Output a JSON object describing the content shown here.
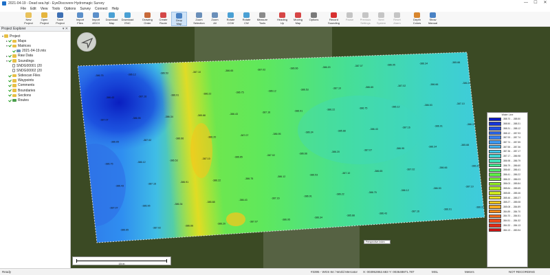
{
  "window": {
    "title": "2021-04-19 - Dead sea.hpl - EyeDiscovere Hydromagic Survey",
    "controls": [
      "—",
      "☐",
      "✕"
    ]
  },
  "menu": [
    "File",
    "Edit",
    "View",
    "Tools",
    "Options",
    "Survey",
    "Connect",
    "Help"
  ],
  "toolbar": [
    {
      "label": "New\nProject",
      "icon": "new-project-icon",
      "color": "#e9c25b"
    },
    {
      "label": "Open\nProject",
      "icon": "open-project-icon",
      "color": "#e5b53e"
    },
    {
      "label": "Save\nProject",
      "icon": "save-project-icon",
      "color": "#3d6fb3"
    },
    {
      "label": "Import\nFiles",
      "icon": "import-files-icon",
      "color": "#5b8fc9"
    },
    {
      "label": "Import\nASCII",
      "icon": "import-ascii-icon",
      "color": "#5b8fc9"
    },
    {
      "label": "Download\nMap",
      "icon": "download-map-icon",
      "color": "#4aa0d4"
    },
    {
      "label": "Download\nENC",
      "icon": "download-enc-icon",
      "color": "#4aa0d4"
    },
    {
      "label": "Drawing\nOrder",
      "icon": "drawing-order-icon",
      "color": "#c86a3a"
    },
    {
      "label": "Create\nRoute",
      "icon": "create-route-icon",
      "color": "#d44848"
    },
    {
      "label": "Drop\nMap",
      "icon": "drop-map-icon",
      "color": "#4a82c4"
    },
    {
      "label": "Zoom\nSelection",
      "icon": "zoom-selection-icon",
      "color": "#6a8fb9"
    },
    {
      "label": "Zoom\nAll",
      "icon": "zoom-all-icon",
      "color": "#6a8fb9"
    },
    {
      "label": "Rotate\nCCW",
      "icon": "rotate-ccw-icon",
      "color": "#4aa0d4"
    },
    {
      "label": "Rotate\nCW",
      "icon": "rotate-cw-icon",
      "color": "#4aa0d4"
    },
    {
      "label": "Measure\nTools",
      "icon": "measure-tools-icon",
      "color": "#8a8a8a"
    },
    {
      "label": "Heading\nUp",
      "icon": "heading-up-icon",
      "color": "#d64646"
    },
    {
      "label": "Moving\nMap",
      "icon": "moving-map-icon",
      "color": "#d64646"
    },
    {
      "label": "Options",
      "icon": "options-icon",
      "color": "#7a7a7a"
    },
    {
      "label": "Record\nSounding",
      "icon": "record-icon",
      "color": "#d83030"
    },
    {
      "label": "Pause",
      "icon": "pause-icon",
      "color": "#888888"
    },
    {
      "label": "Previous\nSettings",
      "icon": "previous-settings-icon",
      "color": "#888888"
    },
    {
      "label": "Next\nSystem",
      "icon": "next-system-icon",
      "color": "#888888"
    },
    {
      "label": "Reset\nAlarm",
      "icon": "reset-alarm-icon",
      "color": "#888888"
    },
    {
      "label": "Depth\nColors",
      "icon": "depth-colors-icon",
      "color": "#d8862e"
    },
    {
      "label": "Show\nManual",
      "icon": "show-manual-icon",
      "color": "#4a82c4"
    }
  ],
  "explorer": {
    "title": "Project Explorer",
    "controls": "▾ ✕",
    "tree": [
      {
        "label": "Project",
        "level": 0,
        "icon": "folder",
        "check": false,
        "expander": "▾"
      },
      {
        "label": "Maps",
        "level": 1,
        "icon": "folder",
        "check": true,
        "expander": "▸"
      },
      {
        "label": "Matrices",
        "level": 1,
        "icon": "folder",
        "check": true,
        "expander": "▾"
      },
      {
        "label": "2021-04-19.mtx",
        "level": 2,
        "icon": "grid",
        "check": true,
        "expander": ""
      },
      {
        "label": "Raw Data",
        "level": 1,
        "icon": "folder",
        "check": true,
        "expander": "▸"
      },
      {
        "label": "Soundings",
        "level": 1,
        "icon": "folder",
        "check": true,
        "expander": "▾"
      },
      {
        "label": "SNDG00001 (20",
        "level": 2,
        "icon": "file",
        "check": false,
        "expander": ""
      },
      {
        "label": "SNDG00002 (20",
        "level": 2,
        "icon": "file",
        "check": false,
        "expander": ""
      },
      {
        "label": "Sidescan Files",
        "level": 1,
        "icon": "folder",
        "check": true,
        "expander": ""
      },
      {
        "label": "Waypoints",
        "level": 1,
        "icon": "folder",
        "check": true,
        "expander": ""
      },
      {
        "label": "Comments",
        "level": 1,
        "icon": "folder",
        "check": true,
        "expander": ""
      },
      {
        "label": "Boundaries",
        "level": 1,
        "icon": "folder",
        "check": true,
        "expander": ""
      },
      {
        "label": "Sections",
        "level": 1,
        "icon": "folder",
        "check": true,
        "expander": ""
      },
      {
        "label": "Routes",
        "level": 1,
        "icon": "green",
        "check": true,
        "expander": ""
      }
    ]
  },
  "map": {
    "scale_label": "15 m",
    "tooltip": "Perspective Index",
    "soundings": [
      "-386.75",
      "-386.12",
      "-386.53",
      "-387.10",
      "-386.65",
      "-387.02",
      "-386.66",
      "-386.20",
      "-387.07",
      "-386.95",
      "-386.34",
      "-385.88",
      "-386.43",
      "-387.16",
      "-386.91",
      "-386.22"
    ]
  },
  "legend": {
    "title": "Water Line",
    "colors": [
      "#0a18c8",
      "#1535d8",
      "#1f4fe4",
      "#2a66ec",
      "#3680f0",
      "#3d99f2",
      "#3fb1f0",
      "#3fc6e8",
      "#3ed6d2",
      "#3fe0b6",
      "#44e792",
      "#4fec6c",
      "#5eee47",
      "#74ef2f",
      "#92ee24",
      "#b1ec1f",
      "#cfe81d",
      "#e9de1d",
      "#f8c81c",
      "#fbaa1c",
      "#f98a1c",
      "#f56a1c",
      "#ee4a1a",
      "#e22b17",
      "#cf1414"
    ],
    "values": [
      "-388.70 .. -388.50",
      "-388.50 .. -388.31",
      "-388.31 .. -388.12",
      "-388.12 .. -387.93",
      "-387.93 .. -387.74",
      "-387.74 .. -387.55",
      "-387.55 .. -387.36",
      "-387.36 .. -387.17",
      "-387.17 .. -386.98",
      "-386.98 .. -386.79",
      "-386.79 .. -386.60",
      "-386.60 .. -386.41",
      "-386.41 .. -386.22",
      "-386.22 .. -386.03",
      "-386.03 .. -385.84",
      "-385.84 .. -385.65",
      "-385.65 .. -385.46",
      "-385.46 .. -385.27",
      "-385.27 .. -385.08",
      "-385.08 .. -384.89",
      "-384.89 .. -384.70",
      "-384.70 .. -384.51",
      "-384.51 .. -384.32",
      "-384.32 .. -384.13",
      "-384.13 .. -383.94"
    ]
  },
  "status": {
    "left": "Ready",
    "projection": "#3395 - WGS 84 / World Mercator",
    "coords": "X: 003952862.683  Y: 003648871.787",
    "msl": "MSL",
    "metric": "Meters",
    "recording": "NOT RECORDING"
  }
}
